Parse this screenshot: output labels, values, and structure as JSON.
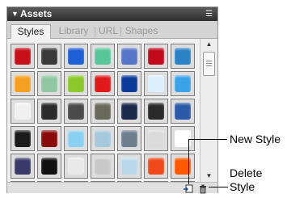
{
  "panel": {
    "title": "Assets",
    "collapse_glyph": "▼",
    "menu_glyph": "☰",
    "tabs": [
      {
        "label": "Styles",
        "active": true
      },
      {
        "label": "Library",
        "active": false
      },
      {
        "label": "URL",
        "active": false
      },
      {
        "label": "Shapes",
        "active": false
      }
    ]
  },
  "swatches": [
    [
      "#c8101a",
      "#3a3a3a",
      "#1e5fd8",
      "#57c79a",
      "#5576c8",
      "#c20a1a",
      "#2b83c6"
    ],
    [
      "#f5a021",
      "#8fc7a0",
      "#8cc82a",
      "#e01a1a",
      "#0c3a9a",
      "#dceefc",
      "#3aa3e8"
    ],
    [
      "#f0f0f0",
      "#2a2a2a",
      "#4a4a4a",
      "#6a6a5a",
      "#1a2a4a",
      "#2a2a2a",
      "#2a5aa8"
    ],
    [
      "#1a1a1a",
      "#8a0a0a",
      "#8ad0f0",
      "#a6c8dc",
      "#6e7e8e",
      "#dadada",
      "#ffffff"
    ],
    [
      "#3a3a6a",
      "#111111",
      "#e8e8e8",
      "#c8c8c8",
      "#b8d8ea",
      "#f04818",
      "#ff5a00"
    ],
    [
      "#d0d0d0",
      "#e8e8e8",
      "#f0c040",
      "#e0e0e0",
      "#c0c0c0",
      "#f0a000",
      "#f08000"
    ]
  ],
  "scrollbar": {
    "up": "▲",
    "down": "▼"
  },
  "footer": {
    "new_style_icon": "new-style-icon",
    "delete_icon": "trash-icon"
  },
  "callouts": {
    "new_style": "New Style",
    "delete_style_line1": "Delete",
    "delete_style_line2": "Style"
  }
}
